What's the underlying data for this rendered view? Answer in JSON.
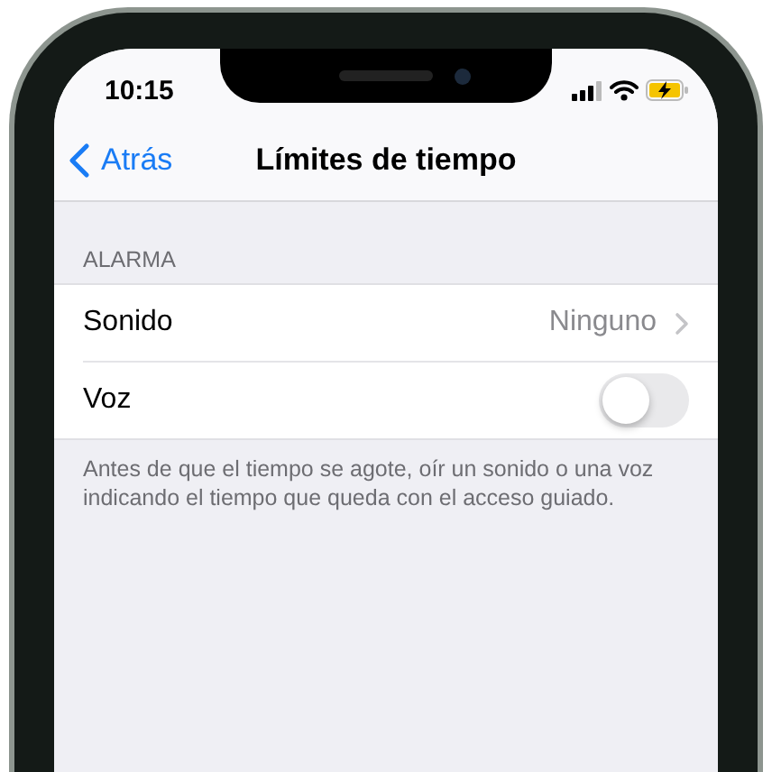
{
  "status_bar": {
    "time": "10:15"
  },
  "nav_bar": {
    "back": "Atrás",
    "title": "Límites de tiempo"
  },
  "section": {
    "header": "ALARMA",
    "rows": [
      {
        "kind": "disclosure",
        "label": "Sonido",
        "value": "Ninguno"
      },
      {
        "kind": "toggle",
        "label": "Voz",
        "on": false
      }
    ],
    "footer": "Antes de que el tiempo se agote, oír un sonido o una voz indicando el tiempo que queda con el acceso guiado."
  }
}
